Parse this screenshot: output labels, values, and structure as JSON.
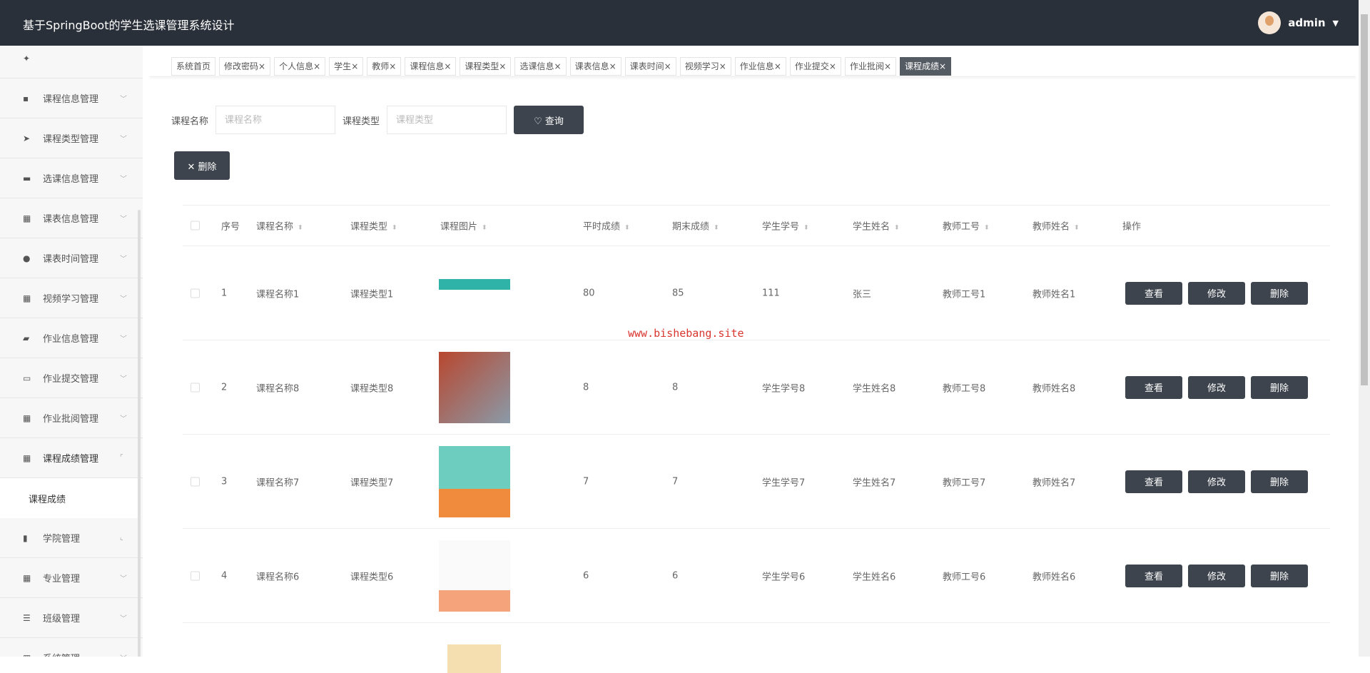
{
  "header": {
    "title": "基于SpringBoot的学生选课管理系统设计",
    "user": "admin"
  },
  "sidebar": {
    "items": [
      {
        "label": "课程信息管理",
        "icon": "comment-icon"
      },
      {
        "label": "课程类型管理",
        "icon": "send-icon"
      },
      {
        "label": "选课信息管理",
        "icon": "book-icon"
      },
      {
        "label": "课表信息管理",
        "icon": "grid-icon"
      },
      {
        "label": "课表时间管理",
        "icon": "user-icon"
      },
      {
        "label": "视频学习管理",
        "icon": "grid-icon"
      },
      {
        "label": "作业信息管理",
        "icon": "briefcase-icon"
      },
      {
        "label": "作业提交管理",
        "icon": "monitor-icon"
      },
      {
        "label": "作业批阅管理",
        "icon": "grid-icon"
      },
      {
        "label": "课程成绩管理",
        "icon": "grid-icon"
      },
      {
        "label": "学院管理",
        "icon": "bar-chart-icon"
      },
      {
        "label": "专业管理",
        "icon": "grid-icon"
      },
      {
        "label": "班级管理",
        "icon": "list-icon"
      },
      {
        "label": "系统管理",
        "icon": "grid-icon"
      }
    ],
    "submenu": "课程成绩"
  },
  "tabs": [
    "系统首页",
    "修改密码",
    "个人信息",
    "学生",
    "教师",
    "课程信息",
    "课程类型",
    "选课信息",
    "课表信息",
    "课表时间",
    "视频学习",
    "作业信息",
    "作业提交",
    "作业批阅",
    "课程成绩"
  ],
  "search": {
    "name_label": "课程名称",
    "name_placeholder": "课程名称",
    "type_label": "课程类型",
    "type_placeholder": "课程类型",
    "query": "查询",
    "delete": "删除"
  },
  "table": {
    "headers": [
      "序号",
      "课程名称",
      "课程类型",
      "课程图片",
      "平时成绩",
      "期末成绩",
      "学生学号",
      "学生姓名",
      "教师工号",
      "教师姓名",
      "操作"
    ],
    "rows": [
      [
        "1",
        "课程名称1",
        "课程类型1",
        "",
        "80",
        "85",
        "111",
        "张三",
        "教师工号1",
        "教师姓名1"
      ],
      [
        "2",
        "课程名称8",
        "课程类型8",
        "",
        "8",
        "8",
        "学生学号8",
        "学生姓名8",
        "教师工号8",
        "教师姓名8"
      ],
      [
        "3",
        "课程名称7",
        "课程类型7",
        "",
        "7",
        "7",
        "学生学号7",
        "学生姓名7",
        "教师工号7",
        "教师姓名7"
      ],
      [
        "4",
        "课程名称6",
        "课程类型6",
        "",
        "6",
        "6",
        "学生学号6",
        "学生姓名6",
        "教师工号6",
        "教师姓名6"
      ]
    ],
    "actions": [
      "查看",
      "修改",
      "删除"
    ]
  },
  "watermark": "www.bishebang.site"
}
